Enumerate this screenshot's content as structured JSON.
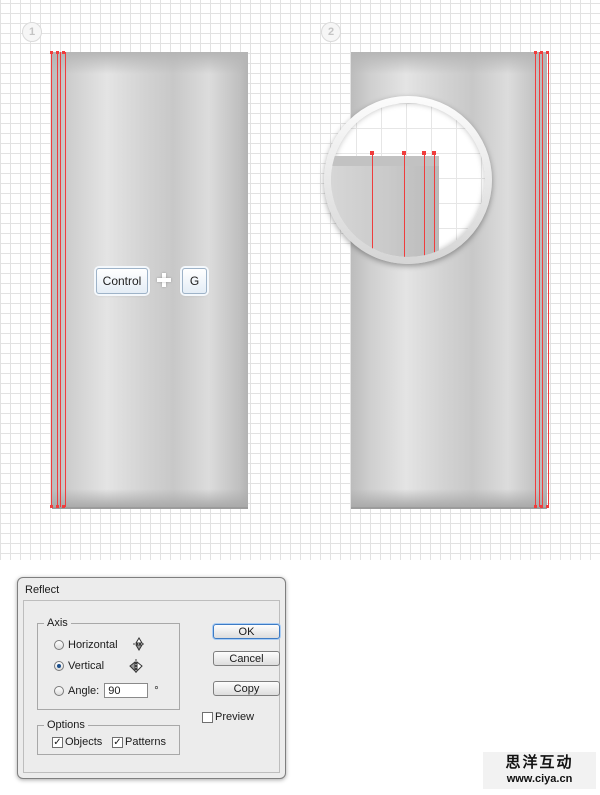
{
  "steps": {
    "step1": "1",
    "step2": "2"
  },
  "shortcut": {
    "key1": "Control",
    "key2": "G",
    "separator_icon": "plus-icon"
  },
  "dialog": {
    "title": "Reflect",
    "axis": {
      "legend": "Axis",
      "horizontal_label": "Horizontal",
      "vertical_label": "Vertical",
      "angle_label": "Angle:",
      "angle_value": "90",
      "degree_symbol": "°",
      "selected": "Vertical"
    },
    "options": {
      "legend": "Options",
      "objects_label": "Objects",
      "objects_checked": true,
      "patterns_label": "Patterns",
      "patterns_checked": true
    },
    "buttons": {
      "ok": "OK",
      "cancel": "Cancel",
      "copy": "Copy"
    },
    "preview_label": "Preview",
    "preview_checked": false
  },
  "watermark": {
    "text": "思洋互动",
    "url": "www.ciya.cn"
  },
  "colors": {
    "path_highlight": "#ef3d3d",
    "key_border": "#9eb3c8",
    "default_button": "#3d7bc4"
  }
}
